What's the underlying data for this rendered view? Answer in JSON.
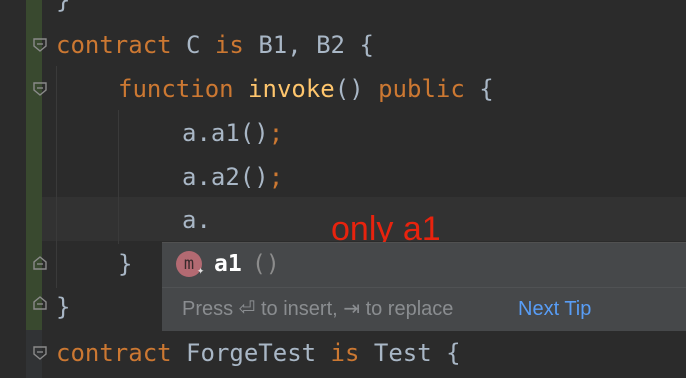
{
  "editor": {
    "lines": {
      "top_brace": "}",
      "contract_c": {
        "keyword": "contract",
        "name": "C",
        "is": "is",
        "bases": "B1, B2",
        "brace": "{"
      },
      "function_invoke": {
        "keyword": "function",
        "name": "invoke",
        "parens": "()",
        "modifier": "public",
        "brace": "{"
      },
      "call_a1": {
        "text": "a.a1()",
        "semicolon": ";"
      },
      "call_a2": {
        "text": "a.a2()",
        "semicolon": ";"
      },
      "typing": {
        "text": "a."
      },
      "close_fn": {
        "brace": "}"
      },
      "close_contract": {
        "brace": "}"
      },
      "contract_forge": {
        "keyword": "contract",
        "name": "ForgeTest",
        "is": "is",
        "base": "Test",
        "brace": "{"
      }
    }
  },
  "annotation": {
    "text": "only a1"
  },
  "completion": {
    "items": [
      {
        "icon": "m",
        "name": "a1",
        "params": "()"
      }
    ],
    "hint": "Press ⏎ to insert, ⇥ to replace",
    "next_tip": "Next Tip"
  },
  "colors": {
    "background": "#2b2b2b",
    "keyword": "#cc7832",
    "function": "#ffc66d",
    "text": "#a9b7c6",
    "annotation": "#e8230e",
    "link": "#589df6"
  }
}
